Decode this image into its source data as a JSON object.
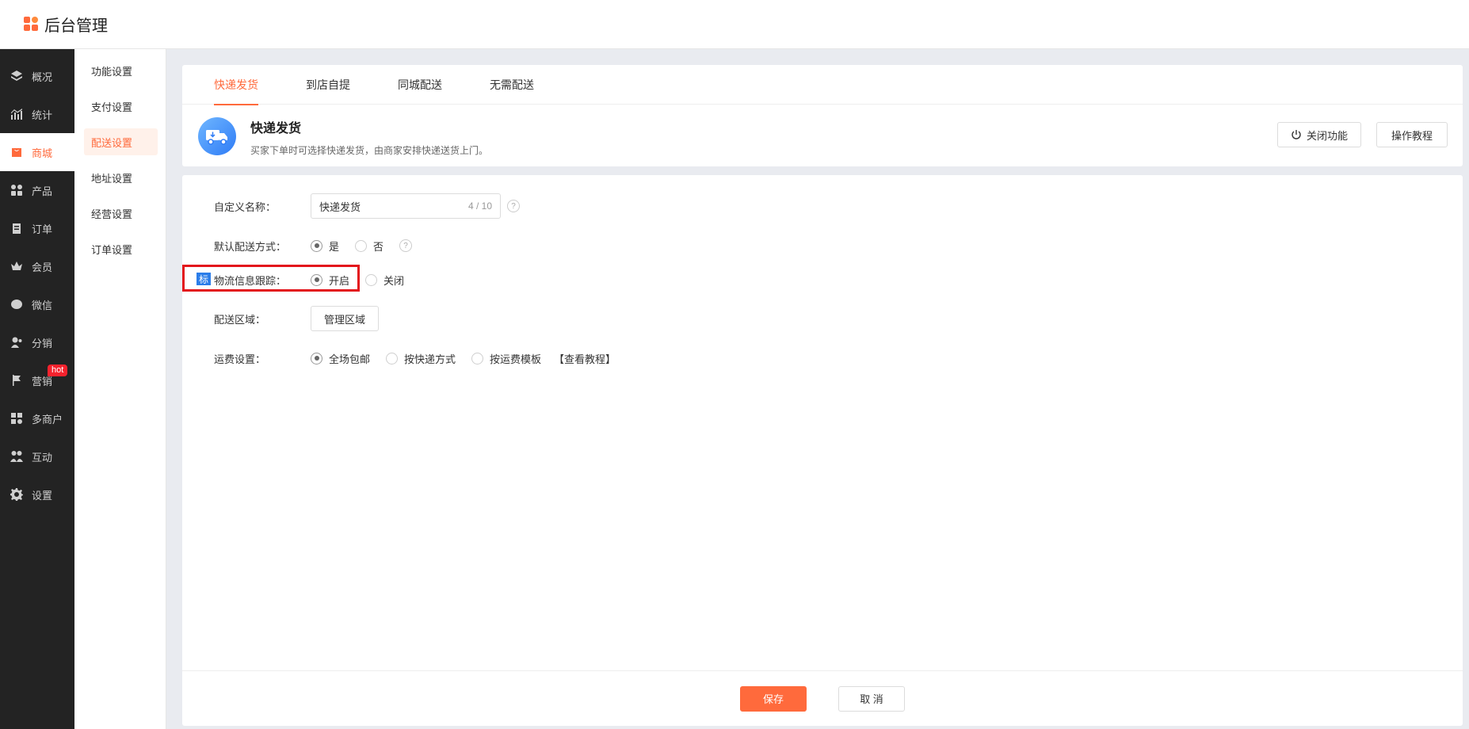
{
  "header": {
    "title": "后台管理"
  },
  "nav_primary": [
    {
      "label": "概况",
      "icon": "layers-icon"
    },
    {
      "label": "统计",
      "icon": "stats-icon"
    },
    {
      "label": "商城",
      "icon": "mall-icon",
      "active": true
    },
    {
      "label": "产品",
      "icon": "product-icon"
    },
    {
      "label": "订单",
      "icon": "order-icon"
    },
    {
      "label": "会员",
      "icon": "crown-icon"
    },
    {
      "label": "微信",
      "icon": "wechat-icon"
    },
    {
      "label": "分销",
      "icon": "distribution-icon"
    },
    {
      "label": "营销",
      "icon": "flag-icon",
      "badge": "hot"
    },
    {
      "label": "多商户",
      "icon": "merchant-icon"
    },
    {
      "label": "互动",
      "icon": "interact-icon"
    },
    {
      "label": "设置",
      "icon": "gear-icon"
    }
  ],
  "nav_secondary": [
    {
      "label": "功能设置"
    },
    {
      "label": "支付设置"
    },
    {
      "label": "配送设置",
      "active": true
    },
    {
      "label": "地址设置"
    },
    {
      "label": "经营设置"
    },
    {
      "label": "订单设置"
    }
  ],
  "tabs": [
    {
      "label": "快递发货",
      "active": true
    },
    {
      "label": "到店自提"
    },
    {
      "label": "同城配送"
    },
    {
      "label": "无需配送"
    }
  ],
  "intro": {
    "title": "快递发货",
    "description": "买家下单时可选择快递发货，由商家安排快递送货上门。",
    "close_button": "关闭功能",
    "tutorial_button": "操作教程"
  },
  "form": {
    "custom_name": {
      "label": "自定义名称：",
      "value": "快递发货",
      "counter": "4 / 10"
    },
    "default_method": {
      "label": "默认配送方式：",
      "options": [
        "是",
        "否"
      ],
      "selected": "是"
    },
    "tracking": {
      "label": "物流信息跟踪：",
      "tag": "标",
      "options": [
        "开启",
        "关闭"
      ],
      "selected": "开启"
    },
    "area": {
      "label": "配送区域：",
      "button": "管理区域"
    },
    "freight": {
      "label": "运费设置：",
      "options": [
        "全场包邮",
        "按快递方式",
        "按运费模板"
      ],
      "selected": "全场包邮",
      "link": "【查看教程】"
    },
    "help_mark": "?"
  },
  "footer": {
    "save": "保存",
    "cancel": "取 消"
  },
  "colors": {
    "accent": "#ff6a3c",
    "sidebar": "#232323",
    "highlight": "#e3141b"
  }
}
